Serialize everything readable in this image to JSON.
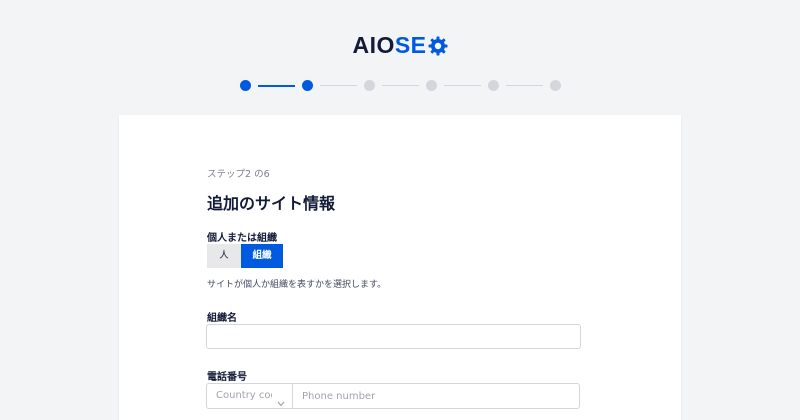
{
  "logo": {
    "part_dark": "AIO",
    "part_blue": "SE",
    "gear_icon": "gear-icon",
    "colors": {
      "dark": "#141b38",
      "blue": "#005ae0"
    }
  },
  "stepper": {
    "total_steps": 6,
    "current_step": 2,
    "active_color": "#005ae0",
    "inactive_color": "#d4d6db"
  },
  "form": {
    "step_label": "ステップ2 の6",
    "title": "追加のサイト情報",
    "person_or_org": {
      "label": "個人または組織",
      "options": [
        "人",
        "組織"
      ],
      "selected": "組織",
      "help": "サイトが個人か組織を表すかを選択します。"
    },
    "org_name": {
      "label": "組織名",
      "value": "",
      "placeholder": ""
    },
    "phone": {
      "label": "電話番号",
      "country_placeholder": "Country code",
      "number_placeholder": "Phone number"
    }
  }
}
